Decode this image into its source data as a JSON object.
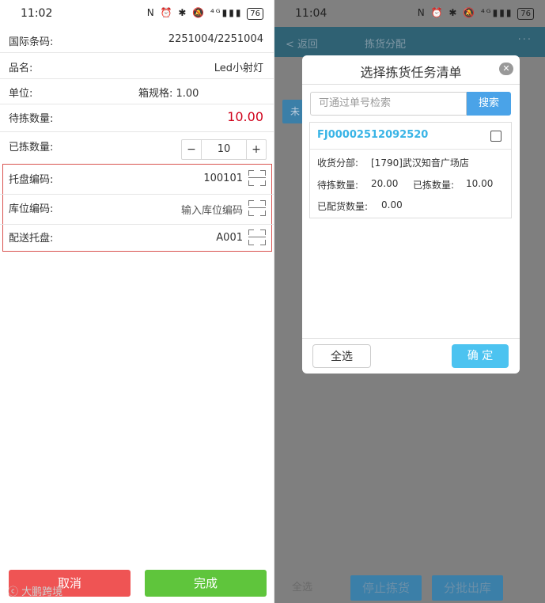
{
  "left": {
    "status_time": "11:02",
    "battery": "76",
    "rows": {
      "barcode_label": "国际条码:",
      "barcode_value": "2251004/2251004",
      "name_label": "品名:",
      "name_value": "Led小射灯",
      "unit_label": "单位:",
      "spec_label": "箱规格: 1.00",
      "to_pick_label": "待拣数量:",
      "to_pick_value": "10.00",
      "picked_label": "已拣数量:",
      "picked_value": "10",
      "minus": "−",
      "plus": "+",
      "pallet_label": "托盘编码:",
      "pallet_value": "100101",
      "location_label": "库位编码:",
      "location_placeholder": "输入库位编码",
      "dispatch_label": "配送托盘:",
      "dispatch_value": "A001"
    },
    "cancel_label": "取消",
    "finish_label": "完成",
    "watermark": "大鹏跨境",
    "colors": {
      "cancel": "#ef5454",
      "finish": "#5fc53c",
      "highlight": "#d0021b"
    }
  },
  "right": {
    "status_time": "11:04",
    "battery": "76",
    "nav_back": "< 返回",
    "nav_title": "拣货分配",
    "nav_more": "···",
    "bg_tab": "未",
    "bg_select_all": "全选",
    "bg_stop": "停止拣货",
    "bg_batch": "分批出库",
    "modal": {
      "title": "选择拣货任务清单",
      "close": "✕",
      "search_placeholder": "可通过单号检索",
      "search_button": "搜索",
      "order_code": "FJ00002512092520",
      "receiver_label": "收货分部:",
      "receiver_value": "[1790]武汉知音广场店",
      "to_pick_label": "待拣数量:",
      "to_pick_value": "20.00",
      "picked_label": "已拣数量:",
      "picked_value": "10.00",
      "allocated_label": "已配货数量:",
      "allocated_value": "0.00",
      "select_all": "全选",
      "confirm": "确 定"
    }
  }
}
